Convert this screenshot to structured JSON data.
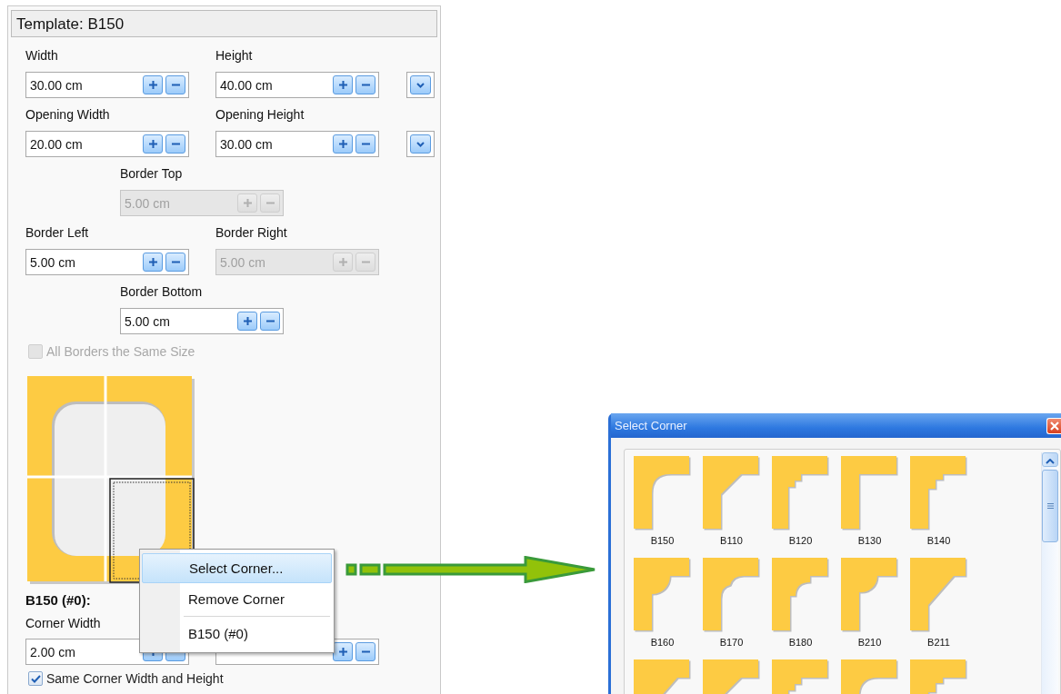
{
  "panel": {
    "title": "Template: B150",
    "fields": [
      {
        "label": "Width",
        "value": "30.00 cm",
        "disabled": false
      },
      {
        "label": "Height",
        "value": "40.00 cm",
        "disabled": false
      },
      {
        "label": "Opening Width",
        "value": "20.00 cm",
        "disabled": false
      },
      {
        "label": "Opening Height",
        "value": "30.00 cm",
        "disabled": false
      },
      {
        "label": "Border Top",
        "value": "5.00 cm",
        "disabled": true
      },
      {
        "label": "Border Left",
        "value": "5.00 cm",
        "disabled": false
      },
      {
        "label": "Border Right",
        "value": "5.00 cm",
        "disabled": true
      },
      {
        "label": "Border Bottom",
        "value": "5.00 cm",
        "disabled": false
      }
    ],
    "all_borders": {
      "label": "All Borders the Same Size",
      "checked": false,
      "disabled": true
    },
    "corner_title": "B150 (#0):",
    "corner_fields": [
      {
        "label": "Corner Width",
        "value": "2.00 cm",
        "disabled": false
      },
      {
        "disabled": false
      }
    ],
    "same_corner": {
      "label": "Same Corner Width and Height",
      "checked": true,
      "disabled": false
    }
  },
  "context_menu": {
    "items": [
      {
        "label": "Select Corner...",
        "selected": true,
        "separator_before": false
      },
      {
        "label": "Remove Corner",
        "selected": false,
        "separator_before": false
      },
      {
        "label": "B150  (#0)",
        "selected": false,
        "separator_before": true
      }
    ]
  },
  "dialog": {
    "title": "Select Corner",
    "thumbnails": [
      {
        "label": "B150",
        "kind": "round"
      },
      {
        "label": "B110",
        "kind": "bevel"
      },
      {
        "label": "B120",
        "kind": "steps"
      },
      {
        "label": "B130",
        "kind": "square"
      },
      {
        "label": "B140",
        "kind": "step"
      },
      {
        "label": "B160",
        "kind": "cove"
      },
      {
        "label": "B170",
        "kind": "ogee"
      },
      {
        "label": "B180",
        "kind": "bead"
      },
      {
        "label": "B210",
        "kind": "loop"
      },
      {
        "label": "B211",
        "kind": "diagonal"
      },
      {
        "kind": "diagonal"
      },
      {
        "kind": "bevel"
      },
      {
        "kind": "steps"
      },
      {
        "kind": "round"
      },
      {
        "kind": "step"
      }
    ]
  }
}
